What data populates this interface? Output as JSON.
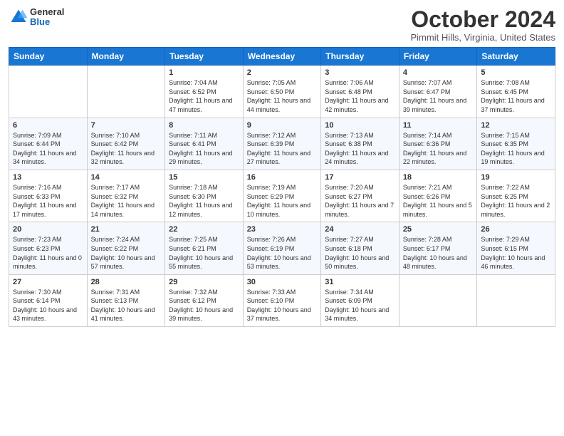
{
  "header": {
    "logo_general": "General",
    "logo_blue": "Blue",
    "month_title": "October 2024",
    "location": "Pimmit Hills, Virginia, United States"
  },
  "weekdays": [
    "Sunday",
    "Monday",
    "Tuesday",
    "Wednesday",
    "Thursday",
    "Friday",
    "Saturday"
  ],
  "weeks": [
    [
      {
        "day": "",
        "info": ""
      },
      {
        "day": "",
        "info": ""
      },
      {
        "day": "1",
        "info": "Sunrise: 7:04 AM\nSunset: 6:52 PM\nDaylight: 11 hours and 47 minutes."
      },
      {
        "day": "2",
        "info": "Sunrise: 7:05 AM\nSunset: 6:50 PM\nDaylight: 11 hours and 44 minutes."
      },
      {
        "day": "3",
        "info": "Sunrise: 7:06 AM\nSunset: 6:48 PM\nDaylight: 11 hours and 42 minutes."
      },
      {
        "day": "4",
        "info": "Sunrise: 7:07 AM\nSunset: 6:47 PM\nDaylight: 11 hours and 39 minutes."
      },
      {
        "day": "5",
        "info": "Sunrise: 7:08 AM\nSunset: 6:45 PM\nDaylight: 11 hours and 37 minutes."
      }
    ],
    [
      {
        "day": "6",
        "info": "Sunrise: 7:09 AM\nSunset: 6:44 PM\nDaylight: 11 hours and 34 minutes."
      },
      {
        "day": "7",
        "info": "Sunrise: 7:10 AM\nSunset: 6:42 PM\nDaylight: 11 hours and 32 minutes."
      },
      {
        "day": "8",
        "info": "Sunrise: 7:11 AM\nSunset: 6:41 PM\nDaylight: 11 hours and 29 minutes."
      },
      {
        "day": "9",
        "info": "Sunrise: 7:12 AM\nSunset: 6:39 PM\nDaylight: 11 hours and 27 minutes."
      },
      {
        "day": "10",
        "info": "Sunrise: 7:13 AM\nSunset: 6:38 PM\nDaylight: 11 hours and 24 minutes."
      },
      {
        "day": "11",
        "info": "Sunrise: 7:14 AM\nSunset: 6:36 PM\nDaylight: 11 hours and 22 minutes."
      },
      {
        "day": "12",
        "info": "Sunrise: 7:15 AM\nSunset: 6:35 PM\nDaylight: 11 hours and 19 minutes."
      }
    ],
    [
      {
        "day": "13",
        "info": "Sunrise: 7:16 AM\nSunset: 6:33 PM\nDaylight: 11 hours and 17 minutes."
      },
      {
        "day": "14",
        "info": "Sunrise: 7:17 AM\nSunset: 6:32 PM\nDaylight: 11 hours and 14 minutes."
      },
      {
        "day": "15",
        "info": "Sunrise: 7:18 AM\nSunset: 6:30 PM\nDaylight: 11 hours and 12 minutes."
      },
      {
        "day": "16",
        "info": "Sunrise: 7:19 AM\nSunset: 6:29 PM\nDaylight: 11 hours and 10 minutes."
      },
      {
        "day": "17",
        "info": "Sunrise: 7:20 AM\nSunset: 6:27 PM\nDaylight: 11 hours and 7 minutes."
      },
      {
        "day": "18",
        "info": "Sunrise: 7:21 AM\nSunset: 6:26 PM\nDaylight: 11 hours and 5 minutes."
      },
      {
        "day": "19",
        "info": "Sunrise: 7:22 AM\nSunset: 6:25 PM\nDaylight: 11 hours and 2 minutes."
      }
    ],
    [
      {
        "day": "20",
        "info": "Sunrise: 7:23 AM\nSunset: 6:23 PM\nDaylight: 11 hours and 0 minutes."
      },
      {
        "day": "21",
        "info": "Sunrise: 7:24 AM\nSunset: 6:22 PM\nDaylight: 10 hours and 57 minutes."
      },
      {
        "day": "22",
        "info": "Sunrise: 7:25 AM\nSunset: 6:21 PM\nDaylight: 10 hours and 55 minutes."
      },
      {
        "day": "23",
        "info": "Sunrise: 7:26 AM\nSunset: 6:19 PM\nDaylight: 10 hours and 53 minutes."
      },
      {
        "day": "24",
        "info": "Sunrise: 7:27 AM\nSunset: 6:18 PM\nDaylight: 10 hours and 50 minutes."
      },
      {
        "day": "25",
        "info": "Sunrise: 7:28 AM\nSunset: 6:17 PM\nDaylight: 10 hours and 48 minutes."
      },
      {
        "day": "26",
        "info": "Sunrise: 7:29 AM\nSunset: 6:15 PM\nDaylight: 10 hours and 46 minutes."
      }
    ],
    [
      {
        "day": "27",
        "info": "Sunrise: 7:30 AM\nSunset: 6:14 PM\nDaylight: 10 hours and 43 minutes."
      },
      {
        "day": "28",
        "info": "Sunrise: 7:31 AM\nSunset: 6:13 PM\nDaylight: 10 hours and 41 minutes."
      },
      {
        "day": "29",
        "info": "Sunrise: 7:32 AM\nSunset: 6:12 PM\nDaylight: 10 hours and 39 minutes."
      },
      {
        "day": "30",
        "info": "Sunrise: 7:33 AM\nSunset: 6:10 PM\nDaylight: 10 hours and 37 minutes."
      },
      {
        "day": "31",
        "info": "Sunrise: 7:34 AM\nSunset: 6:09 PM\nDaylight: 10 hours and 34 minutes."
      },
      {
        "day": "",
        "info": ""
      },
      {
        "day": "",
        "info": ""
      }
    ]
  ]
}
